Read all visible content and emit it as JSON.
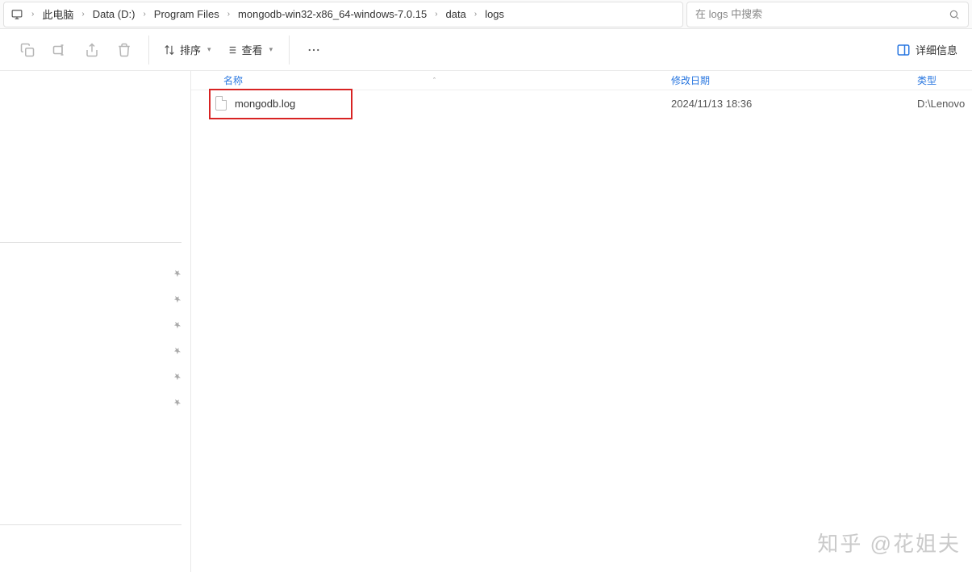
{
  "breadcrumb": {
    "items": [
      "此电脑",
      "Data (D:)",
      "Program Files",
      "mongodb-win32-x86_64-windows-7.0.15",
      "data",
      "logs"
    ]
  },
  "search": {
    "placeholder": "在 logs 中搜索"
  },
  "toolbar": {
    "sort_label": "排序",
    "view_label": "查看",
    "details_label": "详细信息"
  },
  "columns": {
    "name": "名称",
    "date": "修改日期",
    "type": "类型"
  },
  "files": [
    {
      "name": "mongodb.log",
      "date": "2024/11/13 18:36",
      "type": "D:\\Lenovo"
    }
  ],
  "watermark": "知乎 @花姐夫"
}
